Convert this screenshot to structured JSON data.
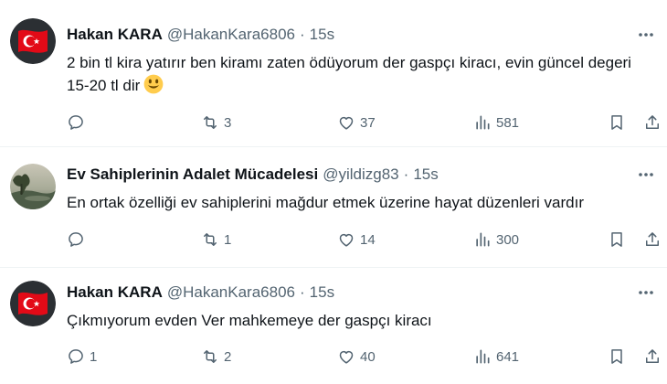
{
  "tweets": [
    {
      "name": "Hakan KARA",
      "handle": "@HakanKara6806",
      "separator": "·",
      "time": "15s",
      "text": "2 bin tl kira yatırır ben kiramı zaten ödüyorum der gaspçı kiracı, evin güncel degeri 15-20 tl dir",
      "emoji": "smiling-face-emoji",
      "replies": "",
      "retweets": "3",
      "likes": "37",
      "views": "581",
      "avatar": "turkish-flag-avatar"
    },
    {
      "name": "Ev Sahiplerinin Adalet Mücadelesi",
      "handle": "@yildizg83",
      "separator": "·",
      "time": "15s",
      "text": "En ortak özelliği ev sahiplerini mağdur etmek üzerine hayat düzenleri vardır",
      "replies": "",
      "retweets": "1",
      "likes": "14",
      "views": "300",
      "avatar": "landscape-photo-avatar"
    },
    {
      "name": "Hakan KARA",
      "handle": "@HakanKara6806",
      "separator": "·",
      "time": "15s",
      "text": "Çıkmıyorum evden Ver mahkemeye der gaspçı kiracı",
      "replies": "1",
      "retweets": "2",
      "likes": "40",
      "views": "641",
      "avatar": "turkish-flag-avatar"
    }
  ],
  "colors": {
    "text": "#0f1419",
    "secondary": "#536471",
    "divider": "#eff3f4",
    "flag_red": "#e30a17",
    "emoji_yellow": "#ffcc4d"
  }
}
